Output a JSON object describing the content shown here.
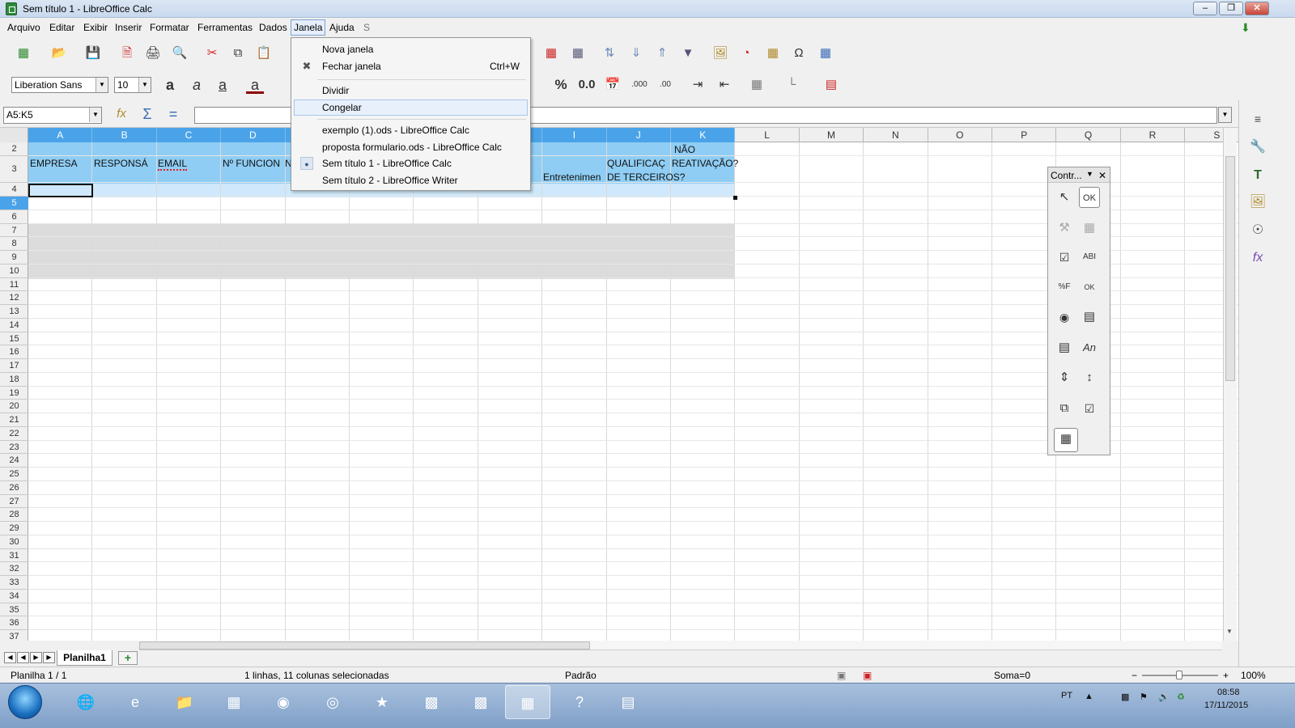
{
  "window": {
    "title": "Sem título 1 - LibreOffice Calc"
  },
  "menubar": {
    "items": [
      "Arquivo",
      "Editar",
      "Exibir",
      "Inserir",
      "Formatar",
      "Ferramentas",
      "Dados",
      "Janela",
      "Ajuda",
      "S"
    ],
    "open_item": "Janela"
  },
  "toolbar": {
    "font_name": "Liberation Sans",
    "font_size": "10",
    "percent_label": "%",
    "decimal_label": "0.0"
  },
  "formula_bar": {
    "name_box": "A5:K5",
    "input_value": ""
  },
  "window_menu": {
    "items": [
      {
        "label": "Nova janela",
        "shortcut": ""
      },
      {
        "label": "Fechar janela",
        "shortcut": "Ctrl+W"
      },
      {
        "label": "Dividir",
        "shortcut": ""
      },
      {
        "label": "Congelar",
        "shortcut": ""
      },
      {
        "label": "exemplo (1).ods - LibreOffice Calc",
        "shortcut": ""
      },
      {
        "label": "proposta formulario.ods - LibreOffice Calc",
        "shortcut": ""
      },
      {
        "label": "Sem título 1 - LibreOffice Calc",
        "shortcut": ""
      },
      {
        "label": "Sem título 2 - LibreOffice Writer",
        "shortcut": ""
      }
    ],
    "highlighted": "Congelar",
    "active_document": "Sem título 1 - LibreOffice Calc"
  },
  "sheet": {
    "columns": [
      "A",
      "B",
      "C",
      "D",
      "E",
      "F",
      "G",
      "H",
      "I",
      "J",
      "K",
      "L",
      "M",
      "N",
      "O",
      "P",
      "Q",
      "R",
      "S"
    ],
    "selected_columns": [
      "A",
      "B",
      "C",
      "D",
      "E",
      "F",
      "G",
      "H",
      "I",
      "J",
      "K"
    ],
    "first_visible_row": 2,
    "last_visible_row": 38,
    "selected_row": 5,
    "cells": [
      {
        "ref": "A3",
        "text": "EMPRESA"
      },
      {
        "ref": "B3",
        "text": "RESPONSÁ"
      },
      {
        "ref": "C3",
        "text": "EMAIL"
      },
      {
        "ref": "D3",
        "text": "Nº FUNCION"
      },
      {
        "ref": "E3",
        "text": "N"
      },
      {
        "ref": "I4",
        "text": "Entretenimen"
      },
      {
        "ref": "J3",
        "text": "QUALIFICAÇ"
      },
      {
        "ref": "J4",
        "text": "DE TERCEIROS?"
      },
      {
        "ref": "K2",
        "text": "NÃO"
      },
      {
        "ref": "K3",
        "text": "REATIVAÇÃO?"
      }
    ]
  },
  "sheet_tabs": {
    "tabs": [
      "Planilha1"
    ],
    "active": "Planilha1"
  },
  "controls_panel": {
    "title": "Contr..."
  },
  "statusbar": {
    "sheet_pos": "Planilha 1 / 1",
    "selection": "1 linhas, 11 colunas selecionadas",
    "style": "Padrão",
    "sum": "Soma=0",
    "zoom": "100%"
  },
  "taskbar": {
    "language": "PT",
    "time": "08:58",
    "date": "17/11/2015"
  },
  "colors": {
    "selection_header": "#4aa3e8",
    "header_band": "#8fcdf4",
    "selected_row_band": "#cfe8fb",
    "gray_band": "#dcdcdc"
  }
}
